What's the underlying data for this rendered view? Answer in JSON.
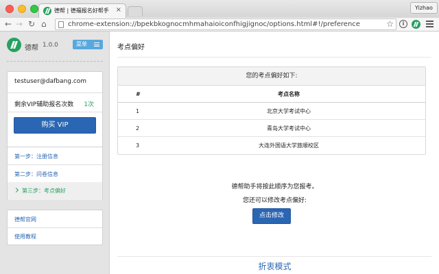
{
  "browser": {
    "tab_title": "德帮 | 德福报名好帮手",
    "tab_close": "×",
    "profile_name": "Yizhao",
    "url": "chrome-extension://bpekbkognocmhmahaioiconfhigjignoc/options.html#!/preference",
    "icons": [
      "back-arrow-icon",
      "forward-arrow-icon",
      "reload-icon",
      "home-icon",
      "page-icon",
      "star-icon",
      "info-icon",
      "extension-icon",
      "hamburger-icon"
    ]
  },
  "sidebar": {
    "brand": {
      "name": "德帮",
      "version": "1.0.0"
    },
    "menu_button": "菜单",
    "account": {
      "email": "testuser@dafbang.com",
      "vip_label": "剩余VIP辅助报名次数",
      "vip_count": "1次",
      "buy_button": "购买 VIP"
    },
    "steps": [
      {
        "label": "第一步：注册信息",
        "active": false
      },
      {
        "label": "第二步：问卷信息",
        "active": false
      },
      {
        "label": "第三步：考点偏好",
        "active": true
      }
    ],
    "links": [
      {
        "label": "德帮官网"
      },
      {
        "label": "使用教程"
      }
    ]
  },
  "main": {
    "title": "考点偏好",
    "table": {
      "caption": "您的考点偏好如下:",
      "headers": [
        "#",
        "考点名称"
      ],
      "rows": [
        {
          "num": "1",
          "name": "北京大学考试中心"
        },
        {
          "num": "2",
          "name": "青岛大学考试中心"
        },
        {
          "num": "3",
          "name": "大连外国语大学旅顺校区"
        }
      ]
    },
    "notice_line1": "德帮助手将按此顺序为您报考。",
    "notice_line2": "您还可以修改考点偏好:",
    "edit_button": "点击修改",
    "fold_link": "折衷模式"
  },
  "colors": {
    "brand_green": "#27a060",
    "primary_blue": "#2a66b3",
    "menu_blue": "#58a8dd",
    "sidebar_bg": "#e4e4e4"
  }
}
